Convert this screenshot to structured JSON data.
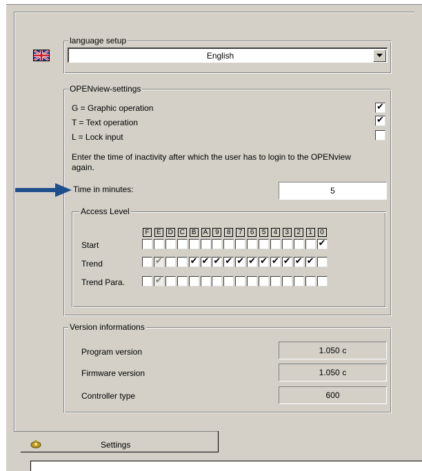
{
  "language": {
    "legend": "language setup",
    "selected": "English",
    "flag_icon": "uk-flag-icon"
  },
  "openview": {
    "legend": "OPENview-settings",
    "options": [
      {
        "label": "G = Graphic operation",
        "checked": true
      },
      {
        "label": "T = Text operation",
        "checked": true
      },
      {
        "label": "L = Lock input",
        "checked": false
      }
    ],
    "inactivity_text": "Enter the time of inactivity after which the user has to login to the OPENview again.",
    "time_label": "Time in minutes:",
    "time_value": "5"
  },
  "access": {
    "legend": "Access Level",
    "columns": [
      "F",
      "E",
      "D",
      "C",
      "B",
      "A",
      "9",
      "8",
      "7",
      "6",
      "5",
      "4",
      "3",
      "2",
      "1",
      "0"
    ],
    "rows": [
      {
        "label": "Start",
        "checks": [
          0,
          0,
          0,
          0,
          0,
          0,
          0,
          0,
          0,
          0,
          0,
          0,
          0,
          0,
          0,
          1
        ],
        "gray": []
      },
      {
        "label": "Trend",
        "checks": [
          0,
          1,
          0,
          0,
          1,
          1,
          1,
          1,
          1,
          1,
          1,
          1,
          1,
          1,
          1,
          0
        ],
        "gray": [
          1
        ]
      },
      {
        "label": "Trend Para.",
        "checks": [
          0,
          1,
          0,
          0,
          0,
          0,
          0,
          0,
          0,
          0,
          0,
          0,
          0,
          0,
          0,
          0
        ],
        "gray": [
          1
        ]
      }
    ]
  },
  "version": {
    "legend": "Version informations",
    "rows": [
      {
        "label": "Program version",
        "value": "1.050",
        "suffix": "c"
      },
      {
        "label": "Firmware version",
        "value": "1.050",
        "suffix": "c"
      },
      {
        "label": "Controller type",
        "value": "600",
        "suffix": ""
      }
    ]
  },
  "tab": {
    "label": "Settings",
    "icon": "settings-icon"
  },
  "colors": {
    "arrow": "#1f4e8c",
    "panel": "#d4d0c8"
  }
}
